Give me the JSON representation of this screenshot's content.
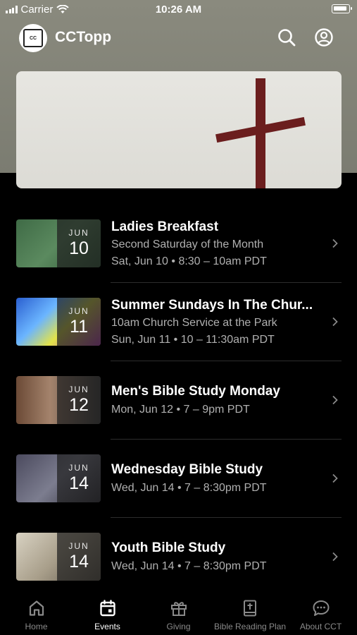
{
  "status_bar": {
    "carrier": "Carrier",
    "time": "10:26 AM"
  },
  "header": {
    "app_title": "CCTopp",
    "logo_text": "CC"
  },
  "events": [
    {
      "month": "JUN",
      "day": "10",
      "title": "Ladies Breakfast",
      "subtitle": "Second Saturday of the Month",
      "when": "Sat, Jun 10 • 8:30 – 10am PDT"
    },
    {
      "month": "JUN",
      "day": "11",
      "title": "Summer Sundays In The Chur...",
      "subtitle": "10am Church Service at the Park",
      "when": "Sun, Jun 11 • 10 – 11:30am PDT"
    },
    {
      "month": "JUN",
      "day": "12",
      "title": "Men's Bible Study Monday",
      "when": "Mon, Jun 12 • 7 – 9pm PDT"
    },
    {
      "month": "JUN",
      "day": "14",
      "title": "Wednesday Bible Study",
      "when": "Wed, Jun 14 • 7 – 8:30pm PDT"
    },
    {
      "month": "JUN",
      "day": "14",
      "title": "Youth Bible Study",
      "when": "Wed, Jun 14 • 7 – 8:30pm PDT"
    }
  ],
  "tabs": [
    {
      "label": "Home",
      "icon": "home-icon"
    },
    {
      "label": "Events",
      "icon": "calendar-icon",
      "active": true
    },
    {
      "label": "Giving",
      "icon": "gift-icon"
    },
    {
      "label": "Bible Reading Plan",
      "icon": "bible-icon"
    },
    {
      "label": "About CCT",
      "icon": "chat-bubble-icon"
    }
  ],
  "colors": {
    "background": "#000000",
    "header_bg": "#7b7c71",
    "cross": "#6b1e1e",
    "secondary_text": "#b0b0b0",
    "inactive_tab": "#8a8a8a"
  }
}
